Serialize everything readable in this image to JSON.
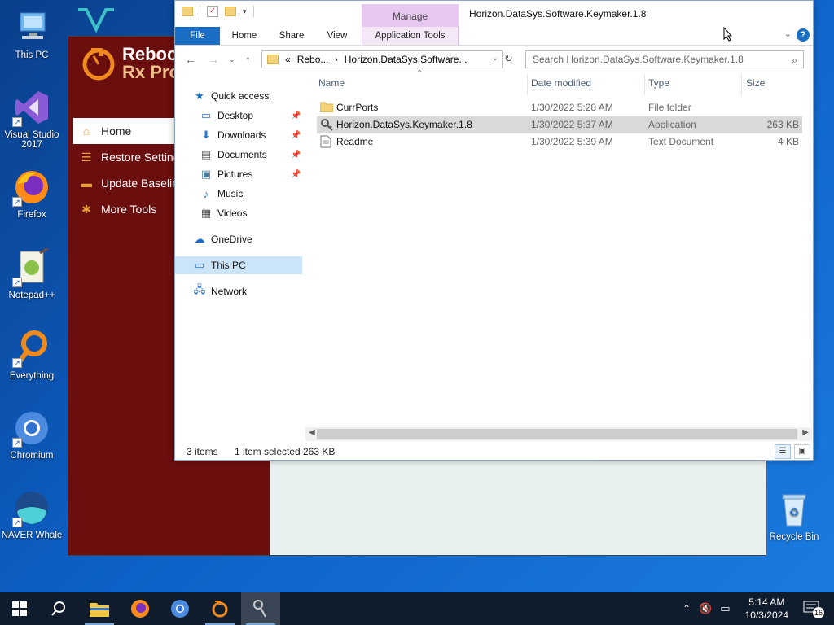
{
  "desktop": {
    "icons": [
      {
        "label": "This PC",
        "icon": "this-pc-icon"
      },
      {
        "label": "Visual Studio 2017",
        "icon": "visual-studio-icon"
      },
      {
        "label": "Firefox",
        "icon": "firefox-icon"
      },
      {
        "label": "Notepad++",
        "icon": "notepadpp-icon"
      },
      {
        "label": "Everything",
        "icon": "everything-icon"
      },
      {
        "label": "Chromium",
        "icon": "chromium-icon"
      },
      {
        "label": "NAVER Whale",
        "icon": "naver-whale-icon"
      },
      {
        "label": "Recycle Bin",
        "icon": "recycle-bin-icon"
      }
    ]
  },
  "reboot": {
    "logo_line1": "Reboo",
    "logo_line2": "Rx Pro",
    "nav": [
      {
        "label": "Home",
        "icon": "home-icon",
        "active": true
      },
      {
        "label": "Restore Setting",
        "icon": "list-icon"
      },
      {
        "label": "Update Baselin",
        "icon": "folder-icon"
      },
      {
        "label": "More Tools",
        "icon": "gear-icon"
      }
    ],
    "accent": "#6b0e0e"
  },
  "explorer": {
    "title": "Horizon.DataSys.Software.Keymaker.1.8",
    "context_tab": "Manage",
    "ribbon_tabs": [
      "File",
      "Home",
      "Share",
      "View",
      "Application Tools"
    ],
    "address": {
      "prefix": "«",
      "crumb1": "Rebo...",
      "crumb2": "Horizon.DataSys.Software..."
    },
    "search_placeholder": "Search Horizon.DataSys.Software.Keymaker.1.8",
    "nav_pane": {
      "quick_access": "Quick access",
      "items": [
        {
          "label": "Desktop",
          "icon": "desktop-icon",
          "pinned": true
        },
        {
          "label": "Downloads",
          "icon": "downloads-icon",
          "pinned": true
        },
        {
          "label": "Documents",
          "icon": "documents-icon",
          "pinned": true
        },
        {
          "label": "Pictures",
          "icon": "pictures-icon",
          "pinned": true
        },
        {
          "label": "Music",
          "icon": "music-icon",
          "pinned": false
        },
        {
          "label": "Videos",
          "icon": "videos-icon",
          "pinned": false
        }
      ],
      "onedrive": "OneDrive",
      "this_pc": "This PC",
      "network": "Network"
    },
    "columns": {
      "name": "Name",
      "date": "Date modified",
      "type": "Type",
      "size": "Size"
    },
    "files": [
      {
        "name": "CurrPorts",
        "date": "1/30/2022 5:28 AM",
        "type": "File folder",
        "size": "",
        "icon": "folder-icon"
      },
      {
        "name": "Horizon.DataSys.Keymaker.1.8",
        "date": "1/30/2022 5:37 AM",
        "type": "Application",
        "size": "263 KB",
        "icon": "application-icon",
        "selected": true
      },
      {
        "name": "Readme",
        "date": "1/30/2022 5:39 AM",
        "type": "Text Document",
        "size": "4 KB",
        "icon": "text-document-icon"
      }
    ],
    "status": {
      "count": "3 items",
      "selected": "1 item selected",
      "size": "263 KB"
    }
  },
  "taskbar": {
    "time": "5:14 AM",
    "date": "10/3/2024",
    "notification_count": "16",
    "apps": [
      "start-icon",
      "search-icon",
      "file-explorer-icon",
      "firefox-icon",
      "chromium-icon",
      "reboot-rx-icon",
      "keymaker-icon"
    ]
  }
}
